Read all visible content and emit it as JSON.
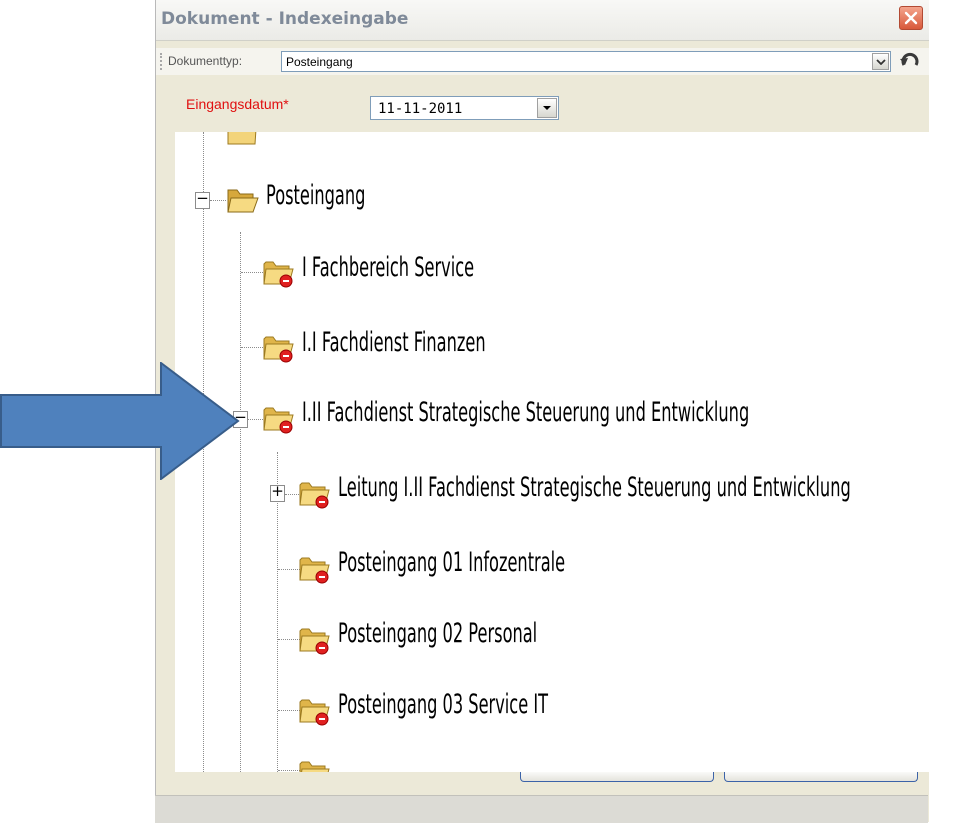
{
  "window": {
    "title": "Dokument - Indexeingabe",
    "close_label": "close"
  },
  "toolbar": {
    "type_label": "Dokumenttyp:",
    "type_value": "Posteingang"
  },
  "form": {
    "date_label": "Eingangsdatum*",
    "date_value": "11-11-2011"
  },
  "tree": {
    "items": [
      {
        "label": "Posteingang"
      },
      {
        "label": "I Fachbereich Service"
      },
      {
        "label": "I.I Fachdienst Finanzen"
      },
      {
        "label": "I.II Fachdienst Strategische Steuerung und Entwicklung"
      },
      {
        "label": "Leitung I.II Fachdienst Strategische Steuerung und Entwicklung"
      },
      {
        "label": "Posteingang 01 Infozentrale"
      },
      {
        "label": "Posteingang 02 Personal"
      },
      {
        "label": "Posteingang 03 Service IT"
      }
    ]
  },
  "colors": {
    "arrow": "#4f81bd",
    "arrow_border": "#385d8a",
    "required_label": "#e01010"
  }
}
